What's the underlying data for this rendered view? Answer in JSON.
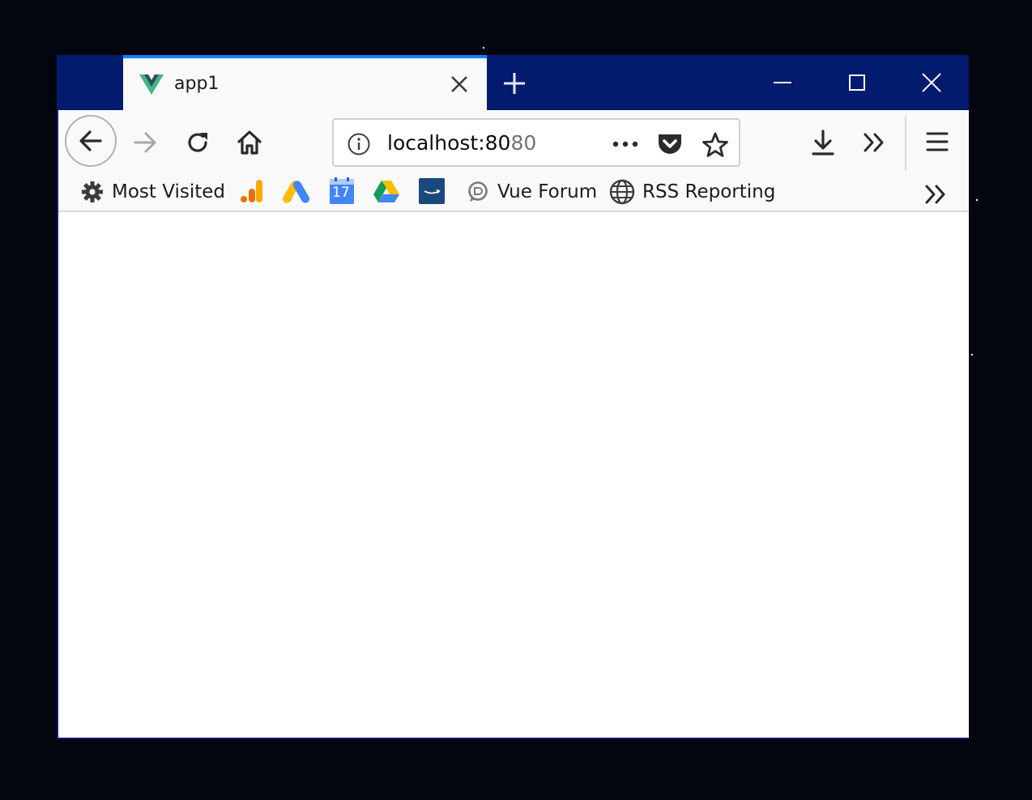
{
  "tab": {
    "title": "app1"
  },
  "url": {
    "host_main": "localhost:80",
    "host_dim": "80"
  },
  "bookmarks": {
    "most_visited": "Most Visited",
    "vue_forum": "Vue Forum",
    "rss_reporting": "RSS Reporting",
    "calendar_day": "17"
  },
  "colors": {
    "titlebar": "#021b6f",
    "tab_accent": "#0a84ff",
    "toolbar": "#f9f9fa",
    "desktop": "#03050f"
  }
}
